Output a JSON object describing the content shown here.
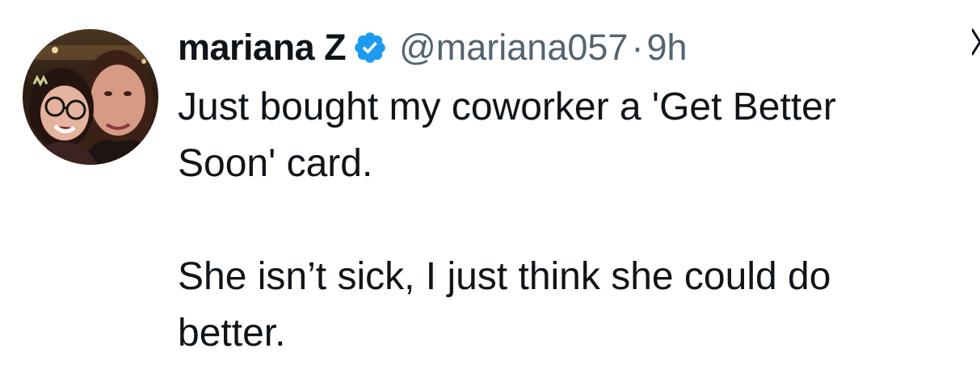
{
  "tweet": {
    "display_name": "mariana Z",
    "handle": "@mariana057",
    "separator": "·",
    "timestamp": "9h",
    "text": "Just bought my coworker a 'Get Better\nSoon' card.\n\nShe isn’t sick, I just think she could do\nbetter.",
    "avatar_icon": "profile-photo",
    "verified_icon": "verified-badge-icon",
    "more_icon": "more-options-icon"
  },
  "colors": {
    "text": "#0f1419",
    "secondary": "#536471",
    "verified": "#1d9bf0",
    "background": "#ffffff"
  }
}
